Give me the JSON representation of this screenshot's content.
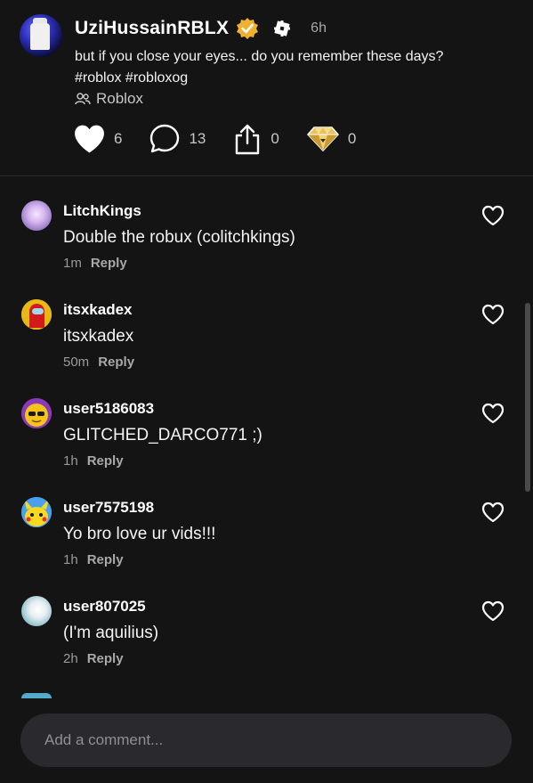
{
  "post": {
    "author": "UziHussainRBLX",
    "time": "6h",
    "caption_line1": "but if you close your eyes... do you remember these days?",
    "caption_line2": "#roblox #robloxog",
    "community": "Roblox",
    "likes": "6",
    "comments": "13",
    "shares": "0",
    "gifts": "0"
  },
  "comments": [
    {
      "name": "LitchKings",
      "text": "Double the robux (colitchkings)",
      "time": "1m",
      "reply_label": "Reply"
    },
    {
      "name": "itsxkadex",
      "text": "itsxkadex",
      "time": "50m",
      "reply_label": "Reply"
    },
    {
      "name": "user5186083",
      "text": "GLITCHED_DARCO771 ;)",
      "time": "1h",
      "reply_label": "Reply"
    },
    {
      "name": "user7575198",
      "text": "Yo bro love ur vids!!!",
      "time": "1h",
      "reply_label": "Reply"
    },
    {
      "name": "user807025",
      "text": "(I'm aquilius)",
      "time": "2h",
      "reply_label": "Reply"
    }
  ],
  "composer": {
    "placeholder": "Add a comment..."
  },
  "icons": {
    "like": "heart-icon",
    "comment": "speech-bubble-icon",
    "share": "share-icon",
    "gift": "diamond-icon",
    "verified": "verified-badge-icon",
    "roblox": "roblox-logo-icon",
    "community": "people-icon"
  },
  "colors": {
    "background": "#141414",
    "verified_badge": "#f0b030",
    "muted_text": "#9a9a9a",
    "composer_bg": "#2a2a2e"
  }
}
